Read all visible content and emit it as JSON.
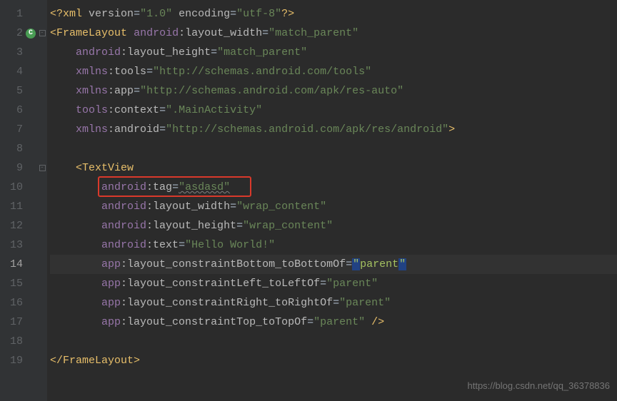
{
  "file_type": "xml",
  "current_line": 14,
  "gutter": {
    "lines": [
      1,
      2,
      3,
      4,
      5,
      6,
      7,
      8,
      9,
      10,
      11,
      12,
      13,
      14,
      15,
      16,
      17,
      18,
      19
    ],
    "marker_line": 2,
    "marker_glyph": "C"
  },
  "fold": {
    "2": "minus",
    "9": "minus"
  },
  "code": {
    "l1": {
      "pi_open": "<?",
      "tag": "xml",
      "a1ns": "",
      "a1nm": "version",
      "a1v": "\"1.0\"",
      "a2nm": "encoding",
      "a2v": "\"utf-8\"",
      "pi_close": "?>"
    },
    "l2": {
      "open": "<",
      "tag": "FrameLayout",
      "ns": "android",
      "nm": "layout_width",
      "v": "\"match_parent\""
    },
    "l3": {
      "ns": "android",
      "nm": "layout_height",
      "v": "\"match_parent\""
    },
    "l4": {
      "ns": "xmlns",
      "nm": "tools",
      "v": "\"http://schemas.android.com/tools\""
    },
    "l5": {
      "ns": "xmlns",
      "nm": "app",
      "v": "\"http://schemas.android.com/apk/res-auto\""
    },
    "l6": {
      "ns": "tools",
      "nm": "context",
      "v": "\".MainActivity\""
    },
    "l7": {
      "ns": "xmlns",
      "nm": "android",
      "v": "\"http://schemas.android.com/apk/res/android\"",
      "close": ">"
    },
    "l9": {
      "open": "<",
      "tag": "TextView"
    },
    "l10": {
      "ns": "android",
      "nm": "tag",
      "v": "\"asdasd\""
    },
    "l11": {
      "ns": "android",
      "nm": "layout_width",
      "v": "\"wrap_content\""
    },
    "l12": {
      "ns": "android",
      "nm": "layout_height",
      "v": "\"wrap_content\""
    },
    "l13": {
      "ns": "android",
      "nm": "text",
      "v": "\"Hello World!\""
    },
    "l14": {
      "ns": "app",
      "nm": "layout_constraintBottom_toBottomOf",
      "q": "\"",
      "v": "parent"
    },
    "l15": {
      "ns": "app",
      "nm": "layout_constraintLeft_toLeftOf",
      "v": "\"parent\""
    },
    "l16": {
      "ns": "app",
      "nm": "layout_constraintRight_toRightOf",
      "v": "\"parent\""
    },
    "l17": {
      "ns": "app",
      "nm": "layout_constraintTop_toTopOf",
      "v": "\"parent\"",
      "close": " />"
    },
    "l19": {
      "open": "</",
      "tag": "FrameLayout",
      "close": ">"
    }
  },
  "highlight_box": {
    "line": 10,
    "target": "android:tag=\"asdasd\""
  },
  "watermark": "https://blog.csdn.net/qq_36378836",
  "colors": {
    "bg": "#2b2b2b",
    "gutter": "#313335",
    "tag": "#e8bf6a",
    "ns": "#9876aa",
    "str": "#6a8759",
    "redbox": "#d9392b"
  }
}
